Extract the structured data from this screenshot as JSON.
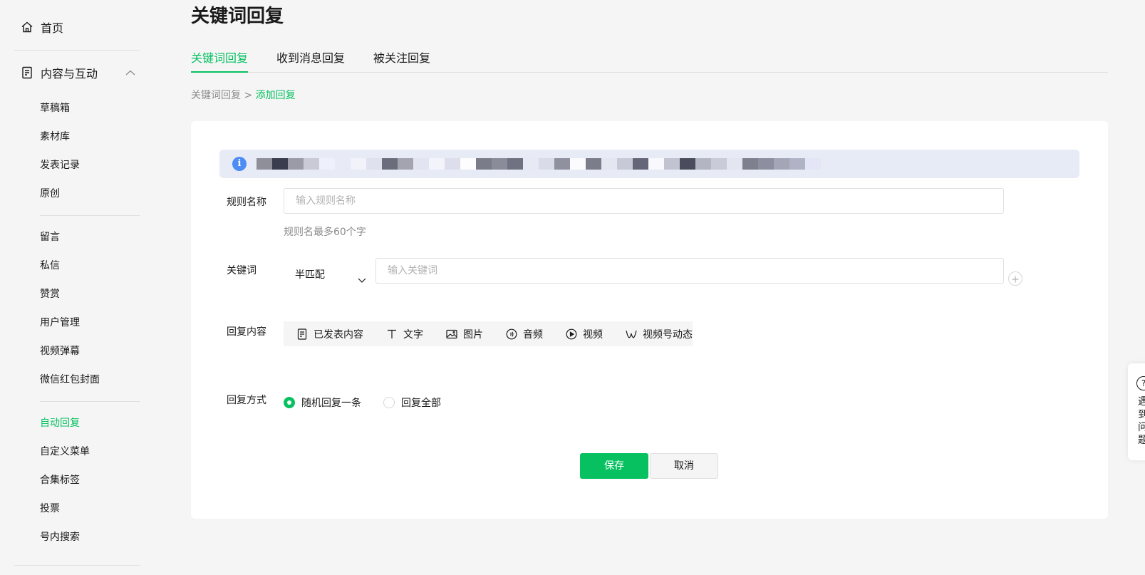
{
  "sidebar": {
    "home": "首页",
    "group": "内容与互动",
    "section1": [
      "草稿箱",
      "素材库",
      "发表记录",
      "原创"
    ],
    "section2": [
      "留言",
      "私信",
      "赞赏",
      "用户管理",
      "视频弹幕",
      "微信红包封面"
    ],
    "section3": [
      "自动回复",
      "自定义菜单",
      "合集标签",
      "投票",
      "号内搜索"
    ]
  },
  "page": {
    "title": "关键词回复",
    "tabs": [
      "关键词回复",
      "收到消息回复",
      "被关注回复"
    ],
    "breadcrumb_parent": "关键词回复",
    "breadcrumb_sep": " > ",
    "breadcrumb_current": "添加回复"
  },
  "form": {
    "rule_name_label": "规则名称",
    "rule_name_placeholder": "输入规则名称",
    "rule_name_hint": "规则名最多60个字",
    "keyword_label": "关键词",
    "match_mode": "半匹配",
    "keyword_placeholder": "输入关键词",
    "reply_content_label": "回复内容",
    "reply_types": [
      "已发表内容",
      "文字",
      "图片",
      "音频",
      "视频",
      "视频号动态"
    ],
    "reply_mode_label": "回复方式",
    "reply_modes": [
      "随机回复一条",
      "回复全部"
    ],
    "save": "保存",
    "cancel": "取消"
  },
  "help_float": {
    "icon": "?",
    "text": "遇到问题"
  },
  "colors": {
    "accent": "#07c160",
    "info": "#4c8cf5",
    "notice_bg": "#e6ebf5"
  }
}
